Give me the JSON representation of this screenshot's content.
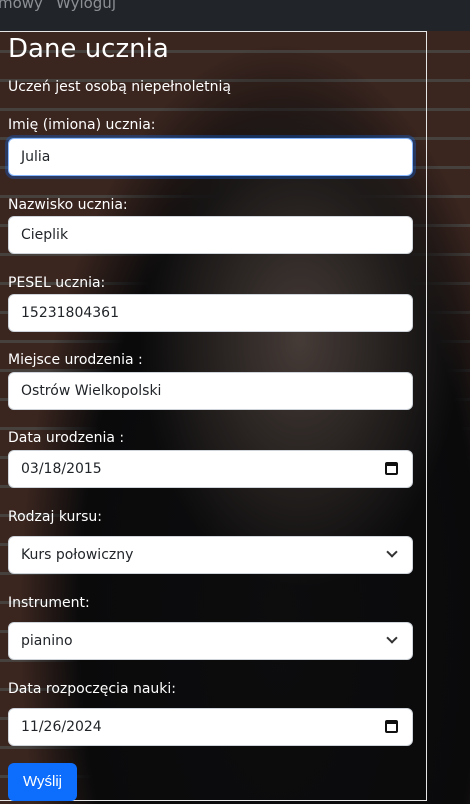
{
  "nav": {
    "items": [
      "mowy",
      "Wyloguj"
    ]
  },
  "form": {
    "title": "Dane ucznia",
    "note": "Uczeń jest osobą niepełnoletnią",
    "fields": [
      {
        "label": "Imię (imiona) ucznia:",
        "value": "Julia"
      },
      {
        "label": "Nazwisko ucznia:",
        "value": "Cieplik"
      },
      {
        "label": "PESEL ucznia:",
        "value": "15231804361"
      },
      {
        "label": "Miejsce urodzenia :",
        "value": "Ostrów Wielkopolski"
      },
      {
        "label": "Data urodzenia :",
        "value": "03/18/2015"
      },
      {
        "label": "Rodzaj kursu:",
        "value": "Kurs połowiczny"
      },
      {
        "label": "Instrument:",
        "value": "pianino"
      },
      {
        "label": "Data rozpoczęcia nauki:",
        "value": "11/26/2024"
      }
    ],
    "submit": "Wyślij"
  },
  "colors": {
    "accent": "#0d6efd",
    "navbar": "#212529"
  }
}
